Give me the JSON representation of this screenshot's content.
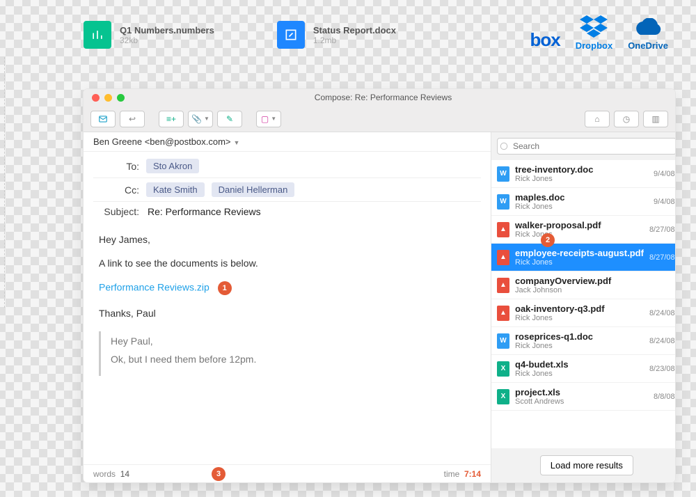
{
  "top_files": [
    {
      "name": "Q1 Numbers.numbers",
      "size": "32kb",
      "icon": "chart",
      "color": "green"
    },
    {
      "name": "Status Report.docx",
      "size": "1.2mb",
      "icon": "edit",
      "color": "blue"
    }
  ],
  "services": {
    "box": "box",
    "dropbox": "Dropbox",
    "onedrive": "OneDrive"
  },
  "window": {
    "title": "Compose: Re: Performance Reviews",
    "from": "Ben Greene <ben@postbox.com>",
    "to_label": "To:",
    "cc_label": "Cc:",
    "subject_label": "Subject:",
    "to": [
      "Sto Akron"
    ],
    "cc": [
      "Kate Smith",
      "Daniel Hellerman"
    ],
    "subject": "Re: Performance Reviews",
    "body": {
      "greeting": "Hey James,",
      "line1": "A link to see the documents is below.",
      "link": "Performance Reviews.zip",
      "signoff": "Thanks, Paul",
      "quote1": "Hey Paul,",
      "quote2": "Ok, but I need them before 12pm."
    },
    "status": {
      "words_label": "words",
      "words": "14",
      "time_label": "time",
      "time": "7:14"
    }
  },
  "markers": {
    "m1": "1",
    "m2": "2",
    "m3": "3"
  },
  "search_placeholder": "Search",
  "files": [
    {
      "name": "tree-inventory.doc",
      "who": "Rick Jones",
      "date": "9/4/08",
      "type": "w"
    },
    {
      "name": "maples.doc",
      "who": "Rick Jones",
      "date": "9/4/08",
      "type": "w"
    },
    {
      "name": "walker-proposal.pdf",
      "who": "Rick Jones",
      "date": "8/27/08",
      "type": "p"
    },
    {
      "name": "employee-receipts-august.pdf",
      "who": "Rick Jones",
      "date": "8/27/08",
      "type": "p",
      "selected": true
    },
    {
      "name": "companyOverview.pdf",
      "who": "Jack Johnson",
      "date": "",
      "type": "p"
    },
    {
      "name": "oak-inventory-q3.pdf",
      "who": "Rick Jones",
      "date": "8/24/08",
      "type": "p"
    },
    {
      "name": "roseprices-q1.doc",
      "who": "Rick Jones",
      "date": "8/24/08",
      "type": "w"
    },
    {
      "name": "q4-budet.xls",
      "who": "Rick Jones",
      "date": "8/23/08",
      "type": "x"
    },
    {
      "name": "project.xls",
      "who": "Scott Andrews",
      "date": "8/8/08",
      "type": "x"
    }
  ],
  "more_label": "Load more results"
}
